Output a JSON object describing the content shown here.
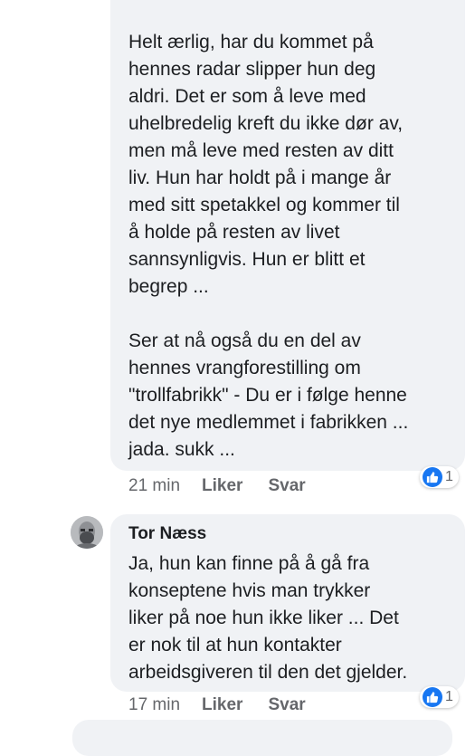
{
  "comments": [
    {
      "paragraphs": [
        "Helt ærlig, har du kommet på\nhennes radar slipper hun deg\naldri. Det er som å leve med\nuhelbredelig kreft du ikke dør av,\nmen må leve med resten av ditt\nliv. Hun har holdt på i mange år\nmed sitt spetakkel og kommer til\nå holde på resten av livet\nsannsynligvis. Hun er blitt et\nbegrep ...",
        "Ser at nå også du en del av\nhennes vrangforestilling om\n\"trollfabrikk\" - Du er i følge henne\ndet nye medlemmet i fabrikken ...\njada. sukk ..."
      ],
      "time": "21 min",
      "like_label": "Liker",
      "reply_label": "Svar",
      "reaction_count": "1"
    },
    {
      "author": "Tor Næss",
      "text": "Ja, hun kan finne på å gå fra\nkonseptene hvis man trykker\nliker på noe hun ikke liker ... Det\ner nok til at hun kontakter\narbeidsgiveren til den det gjelder.",
      "time": "17 min",
      "like_label": "Liker",
      "reply_label": "Svar",
      "reaction_count": "1"
    }
  ],
  "icons": {
    "reaction": "thumbs-up-icon",
    "avatar": "user-avatar"
  },
  "colors": {
    "bubble": "#f0f2f5",
    "like_blue": "#1877f2",
    "meta_gray": "#65676b"
  }
}
